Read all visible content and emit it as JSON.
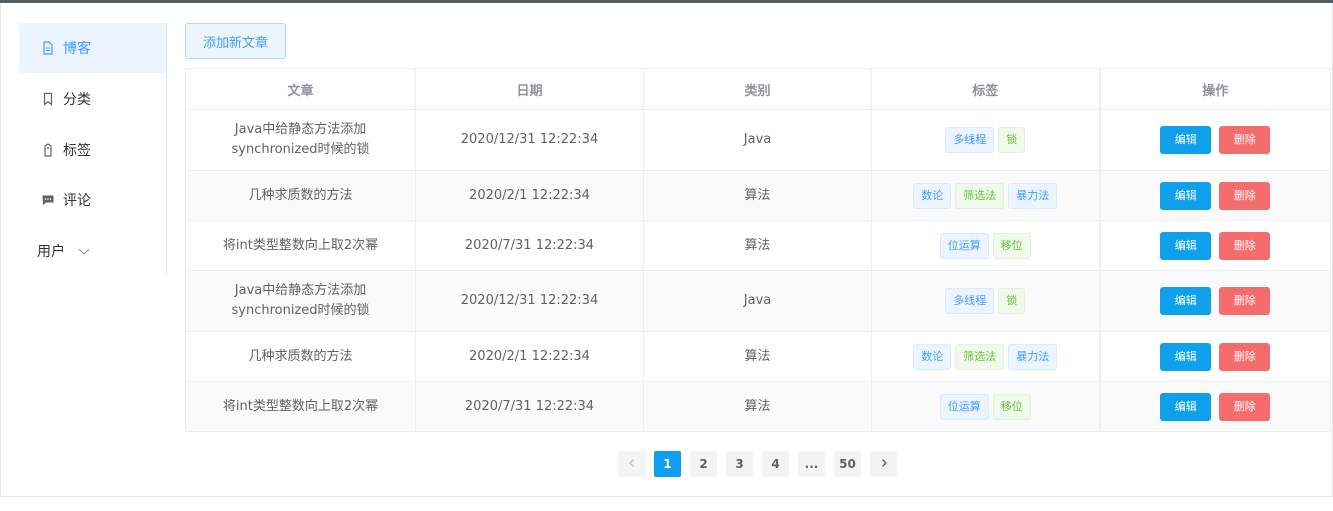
{
  "sidebar": {
    "items": [
      {
        "label": "博客"
      },
      {
        "label": "分类"
      },
      {
        "label": "标签"
      },
      {
        "label": "评论"
      },
      {
        "label": "用户"
      }
    ]
  },
  "toolbar": {
    "add_label": "添加新文章"
  },
  "table": {
    "headers": [
      "文章",
      "日期",
      "类别",
      "标签",
      "操作"
    ],
    "rows": [
      {
        "title": "Java中给静态方法添加synchronized时候的锁",
        "date": "2020/12/31 12:22:34",
        "category": "Java",
        "tags": [
          "多线程",
          "锁"
        ]
      },
      {
        "title": "几种求质数的方法",
        "date": "2020/2/1 12:22:34",
        "category": "算法",
        "tags": [
          "数论",
          "筛选法",
          "暴力法"
        ]
      },
      {
        "title": "将int类型整数向上取2次幂",
        "date": "2020/7/31 12:22:34",
        "category": "算法",
        "tags": [
          "位运算",
          "移位"
        ]
      },
      {
        "title": "Java中给静态方法添加synchronized时候的锁",
        "date": "2020/12/31 12:22:34",
        "category": "Java",
        "tags": [
          "多线程",
          "锁"
        ]
      },
      {
        "title": "几种求质数的方法",
        "date": "2020/2/1 12:22:34",
        "category": "算法",
        "tags": [
          "数论",
          "筛选法",
          "暴力法"
        ]
      },
      {
        "title": "将int类型整数向上取2次幂",
        "date": "2020/7/31 12:22:34",
        "category": "算法",
        "tags": [
          "位运算",
          "移位"
        ]
      }
    ],
    "edit_label": "编辑",
    "delete_label": "删除"
  },
  "pagination": {
    "pages": [
      "1",
      "2",
      "3",
      "4",
      "...",
      "50"
    ],
    "current": "1"
  },
  "colors": {
    "accent": "#409eff",
    "edit_button": "#0fa0ec",
    "delete_button": "#f56c6c",
    "tag_green": "#67c23a"
  }
}
